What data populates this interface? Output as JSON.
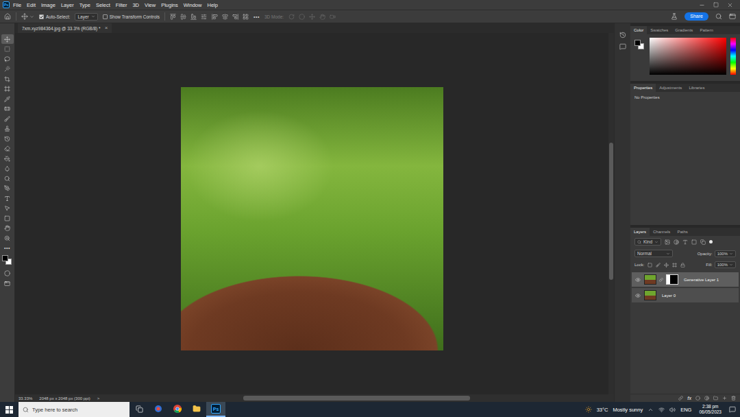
{
  "menu_bar": {
    "logo": "Ps",
    "items": [
      "File",
      "Edit",
      "Image",
      "Layer",
      "Type",
      "Select",
      "Filter",
      "3D",
      "View",
      "Plugins",
      "Window",
      "Help"
    ]
  },
  "options_bar": {
    "auto_select": {
      "label": "Auto-Select:",
      "checked": true
    },
    "target": "Layer",
    "show_transform_controls": {
      "label": "Show Transform Controls",
      "checked": false
    },
    "more": "•••",
    "mode_3d": {
      "label": "3D Mode:",
      "disabled": true
    },
    "share": "Share"
  },
  "document_tabs": [
    {
      "title": "7xm.xyz984364.jpg @ 33.3% (RGB/8) *",
      "close": "×",
      "selected": true
    }
  ],
  "toolbar": {
    "tools": [
      {
        "selected": true
      },
      {
        "selected": false
      },
      {
        "selected": false
      },
      {
        "selected": false
      },
      {
        "selected": false
      },
      {
        "selected": false
      },
      {
        "selected": false
      },
      {
        "selected": false
      },
      {
        "selected": false
      },
      {
        "selected": false
      },
      {
        "selected": false
      },
      {
        "selected": false
      },
      {
        "selected": false
      },
      {
        "selected": false
      },
      {
        "selected": false
      },
      {
        "selected": false
      },
      {
        "selected": false
      },
      {
        "selected": false
      },
      {
        "selected": false
      },
      {
        "selected": false
      },
      {
        "selected": false
      }
    ],
    "more": "•••",
    "foreground": "#000000",
    "background": "#ffffff"
  },
  "color_panel": {
    "tabs": [
      {
        "label": "Color",
        "selected": true
      },
      {
        "label": "Swatches",
        "selected": false
      },
      {
        "label": "Gradients",
        "selected": false
      },
      {
        "label": "Pattern",
        "selected": false
      }
    ],
    "foreground": "#000000",
    "background": "#ffffff"
  },
  "properties_panel": {
    "tabs": [
      {
        "label": "Properties",
        "selected": true
      },
      {
        "label": "Adjustments",
        "selected": false
      },
      {
        "label": "Libraries",
        "selected": false
      }
    ],
    "message": "No Properties"
  },
  "layers_panel": {
    "tabs": [
      {
        "label": "Layers",
        "selected": true
      },
      {
        "label": "Channels",
        "selected": false
      },
      {
        "label": "Paths",
        "selected": false
      }
    ],
    "filter": "Kind",
    "blend_mode": "Normal",
    "opacity": {
      "label": "Opacity:",
      "value": "100%"
    },
    "lock": {
      "label": "Lock:"
    },
    "fill": {
      "label": "Fill:",
      "value": "100%"
    },
    "layers": [
      {
        "name": "Generative Layer 1",
        "visible": true,
        "selected": true,
        "has_mask": true
      },
      {
        "name": "Layer 0",
        "visible": true,
        "selected": false,
        "has_mask": false
      }
    ],
    "footer": {
      "fx": "fx"
    }
  },
  "status_bar": {
    "zoom": "33.33%",
    "document_size": "2048 px x 2048 px (300 ppi)",
    "more": ">"
  },
  "taskbar": {
    "search_placeholder": "Type here to search",
    "apps": [
      {
        "kind": "icon",
        "selected": false
      },
      {
        "kind": "icon",
        "selected": false
      },
      {
        "kind": "icon",
        "selected": false
      },
      {
        "kind": "icon",
        "selected": false
      },
      {
        "kind": "logo",
        "label": "Ps",
        "selected": true
      }
    ],
    "weather": {
      "temperature": "33°C",
      "condition": "Mostly sunny"
    },
    "language": "ENG",
    "time": "2:38 pm",
    "date": "06/05/2023"
  }
}
